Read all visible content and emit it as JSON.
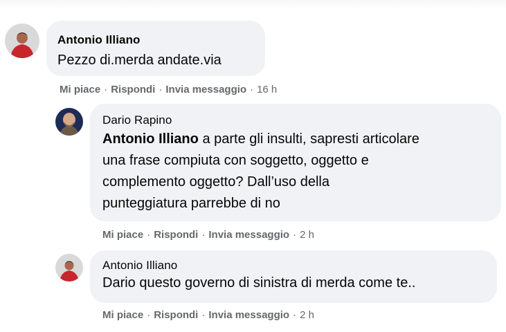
{
  "comments": [
    {
      "author": "Antonio Illiano",
      "mention": "",
      "text": "Pezzo di.merda andate.via",
      "lines": [],
      "actions": {
        "like": "Mi piace",
        "reply": "Rispondi",
        "message": "Invia messaggio",
        "time": "16 h"
      }
    },
    {
      "author": "Dario Rapino",
      "mention": "Antonio Illiano",
      "text": "",
      "lines": [
        "a parte gli insulti, sapresti articolare",
        "una frase compiuta con soggetto, oggetto e",
        "complemento oggetto? Dall’uso della",
        "punteggiatura parrebbe di no"
      ],
      "actions": {
        "like": "Mi piace",
        "reply": "Rispondi",
        "message": "Invia messaggio",
        "time": "2 h"
      }
    },
    {
      "author": "Antonio Illiano",
      "mention": "",
      "text": "Dario questo governo di sinistra di merda come te..",
      "lines": [],
      "actions": {
        "like": "Mi piace",
        "reply": "Rispondi",
        "message": "Invia messaggio",
        "time": "2 h"
      }
    }
  ],
  "separator": "·",
  "colors": {
    "bubble": "#f0f2f5",
    "meta": "#65676b",
    "text": "#050505"
  },
  "icons": {
    "avatar_1": "avatar-red-jersey",
    "avatar_2": "avatar-bald-man",
    "avatar_3": "avatar-red-jersey"
  }
}
